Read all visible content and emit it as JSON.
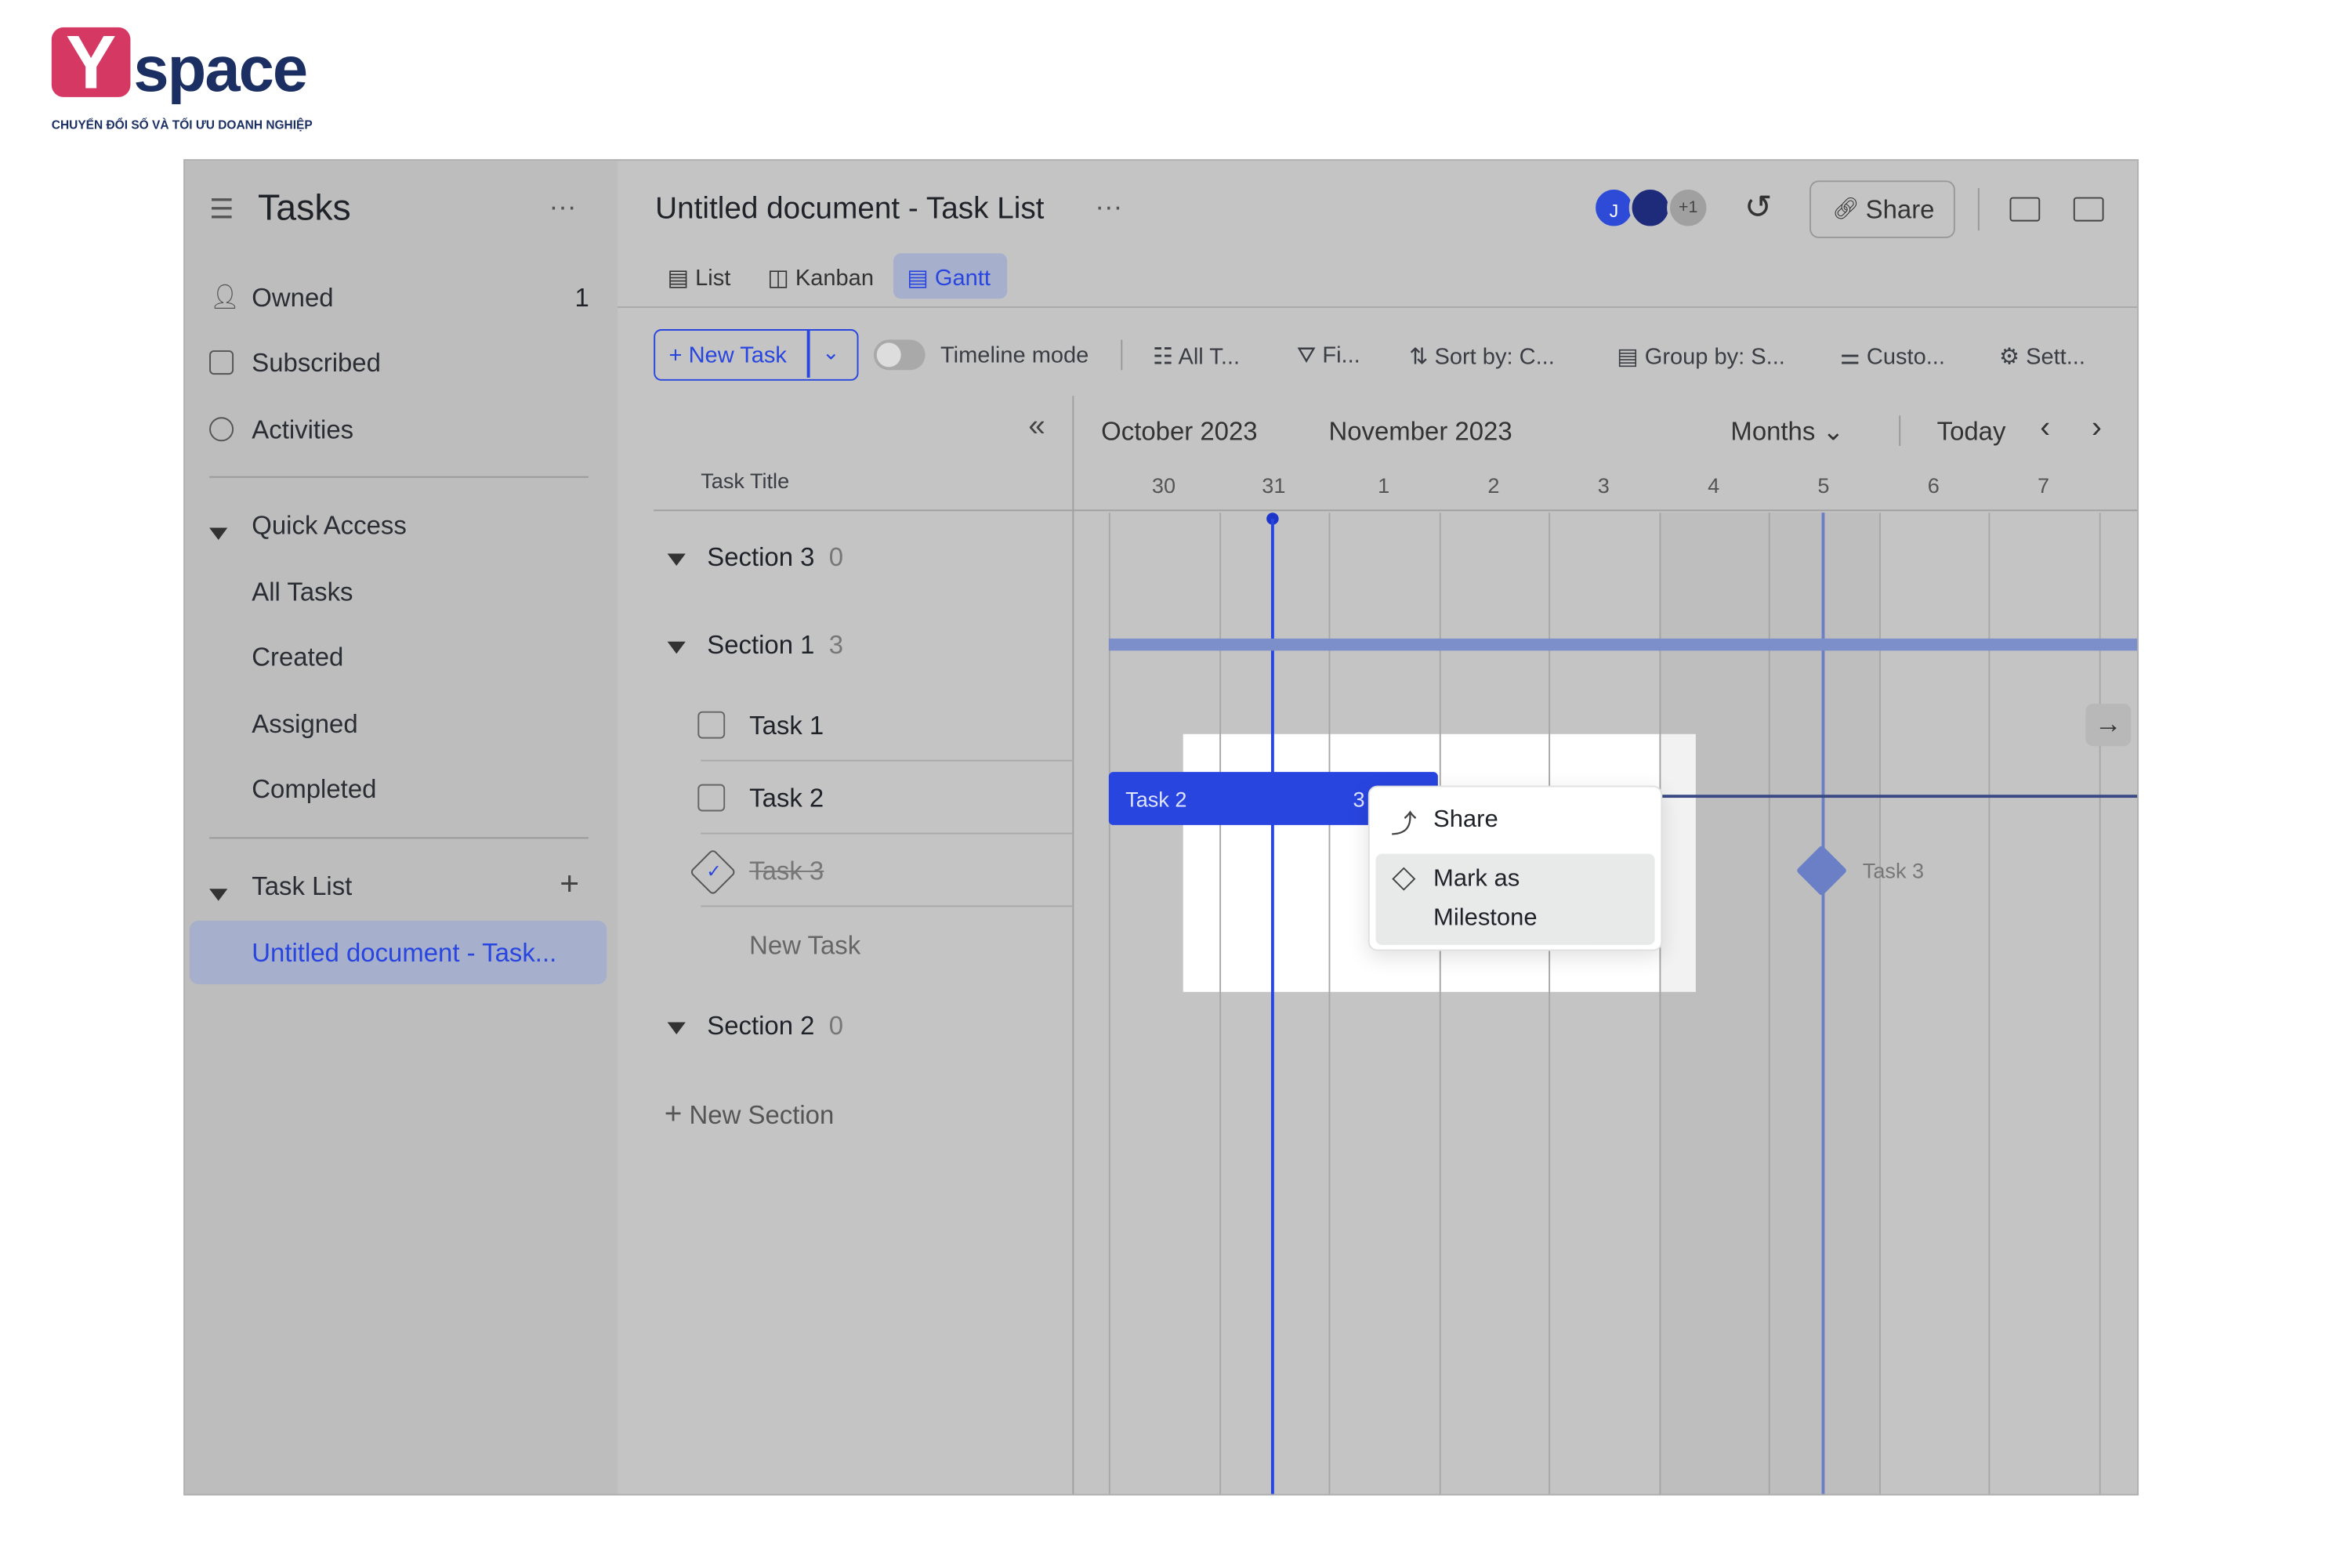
{
  "logo": {
    "letter": "Y",
    "word": "space",
    "tagline": "CHUYỂN ĐỔI SỐ VÀ TỐI ƯU DOANH NGHIỆP"
  },
  "sidebar": {
    "title": "Tasks",
    "more": "···",
    "items": [
      {
        "label": "Owned",
        "count": "1",
        "icon": "user-icon"
      },
      {
        "label": "Subscribed",
        "icon": "bookmark-icon"
      },
      {
        "label": "Activities",
        "icon": "history-icon"
      }
    ],
    "quick_access": {
      "label": "Quick Access",
      "items": [
        "All Tasks",
        "Created",
        "Assigned",
        "Completed"
      ]
    },
    "task_list": {
      "label": "Task List",
      "add": "+",
      "items": [
        "Untitled document - Task..."
      ]
    }
  },
  "header": {
    "title": "Untitled document - Task List",
    "more": "···",
    "avatars": [
      "J",
      "",
      "+1"
    ],
    "share_label": "Share"
  },
  "views": {
    "tabs": [
      "List",
      "Kanban",
      "Gantt"
    ],
    "active": "Gantt"
  },
  "toolbar": {
    "new_task": "+ New Task",
    "timeline_mode": "Timeline mode",
    "timeline_on": false,
    "buttons": [
      "All T...",
      "Fi...",
      "Sort by: C...",
      "Group by: S...",
      "Custo...",
      "Sett..."
    ]
  },
  "gantt": {
    "months": [
      "October 2023",
      "November 2023"
    ],
    "scale": "Months",
    "today": "Today",
    "days": [
      "30",
      "31",
      "1",
      "2",
      "3",
      "4",
      "5",
      "6",
      "7"
    ],
    "column_header": "Task Title",
    "accent": "#2845e0"
  },
  "tasks": {
    "sections": [
      {
        "name": "Section 3",
        "count": "0"
      },
      {
        "name": "Section 1",
        "count": "3",
        "tasks": [
          {
            "name": "Task 1",
            "done": false
          },
          {
            "name": "Task 2",
            "done": false
          },
          {
            "name": "Task 3",
            "done": true
          }
        ],
        "new_task": "New Task"
      },
      {
        "name": "Section 2",
        "count": "0"
      }
    ],
    "new_section": "New Section"
  },
  "bars": {
    "task2_label": "Task 2",
    "task2_count": "3",
    "task3_label": "Task 3"
  },
  "context_menu": {
    "items": [
      {
        "label": "Share",
        "icon": "share-icon"
      },
      {
        "label": "Mark as\nMilestone",
        "line1": "Mark as",
        "line2": "Milestone",
        "icon": "diamond-icon"
      }
    ]
  }
}
